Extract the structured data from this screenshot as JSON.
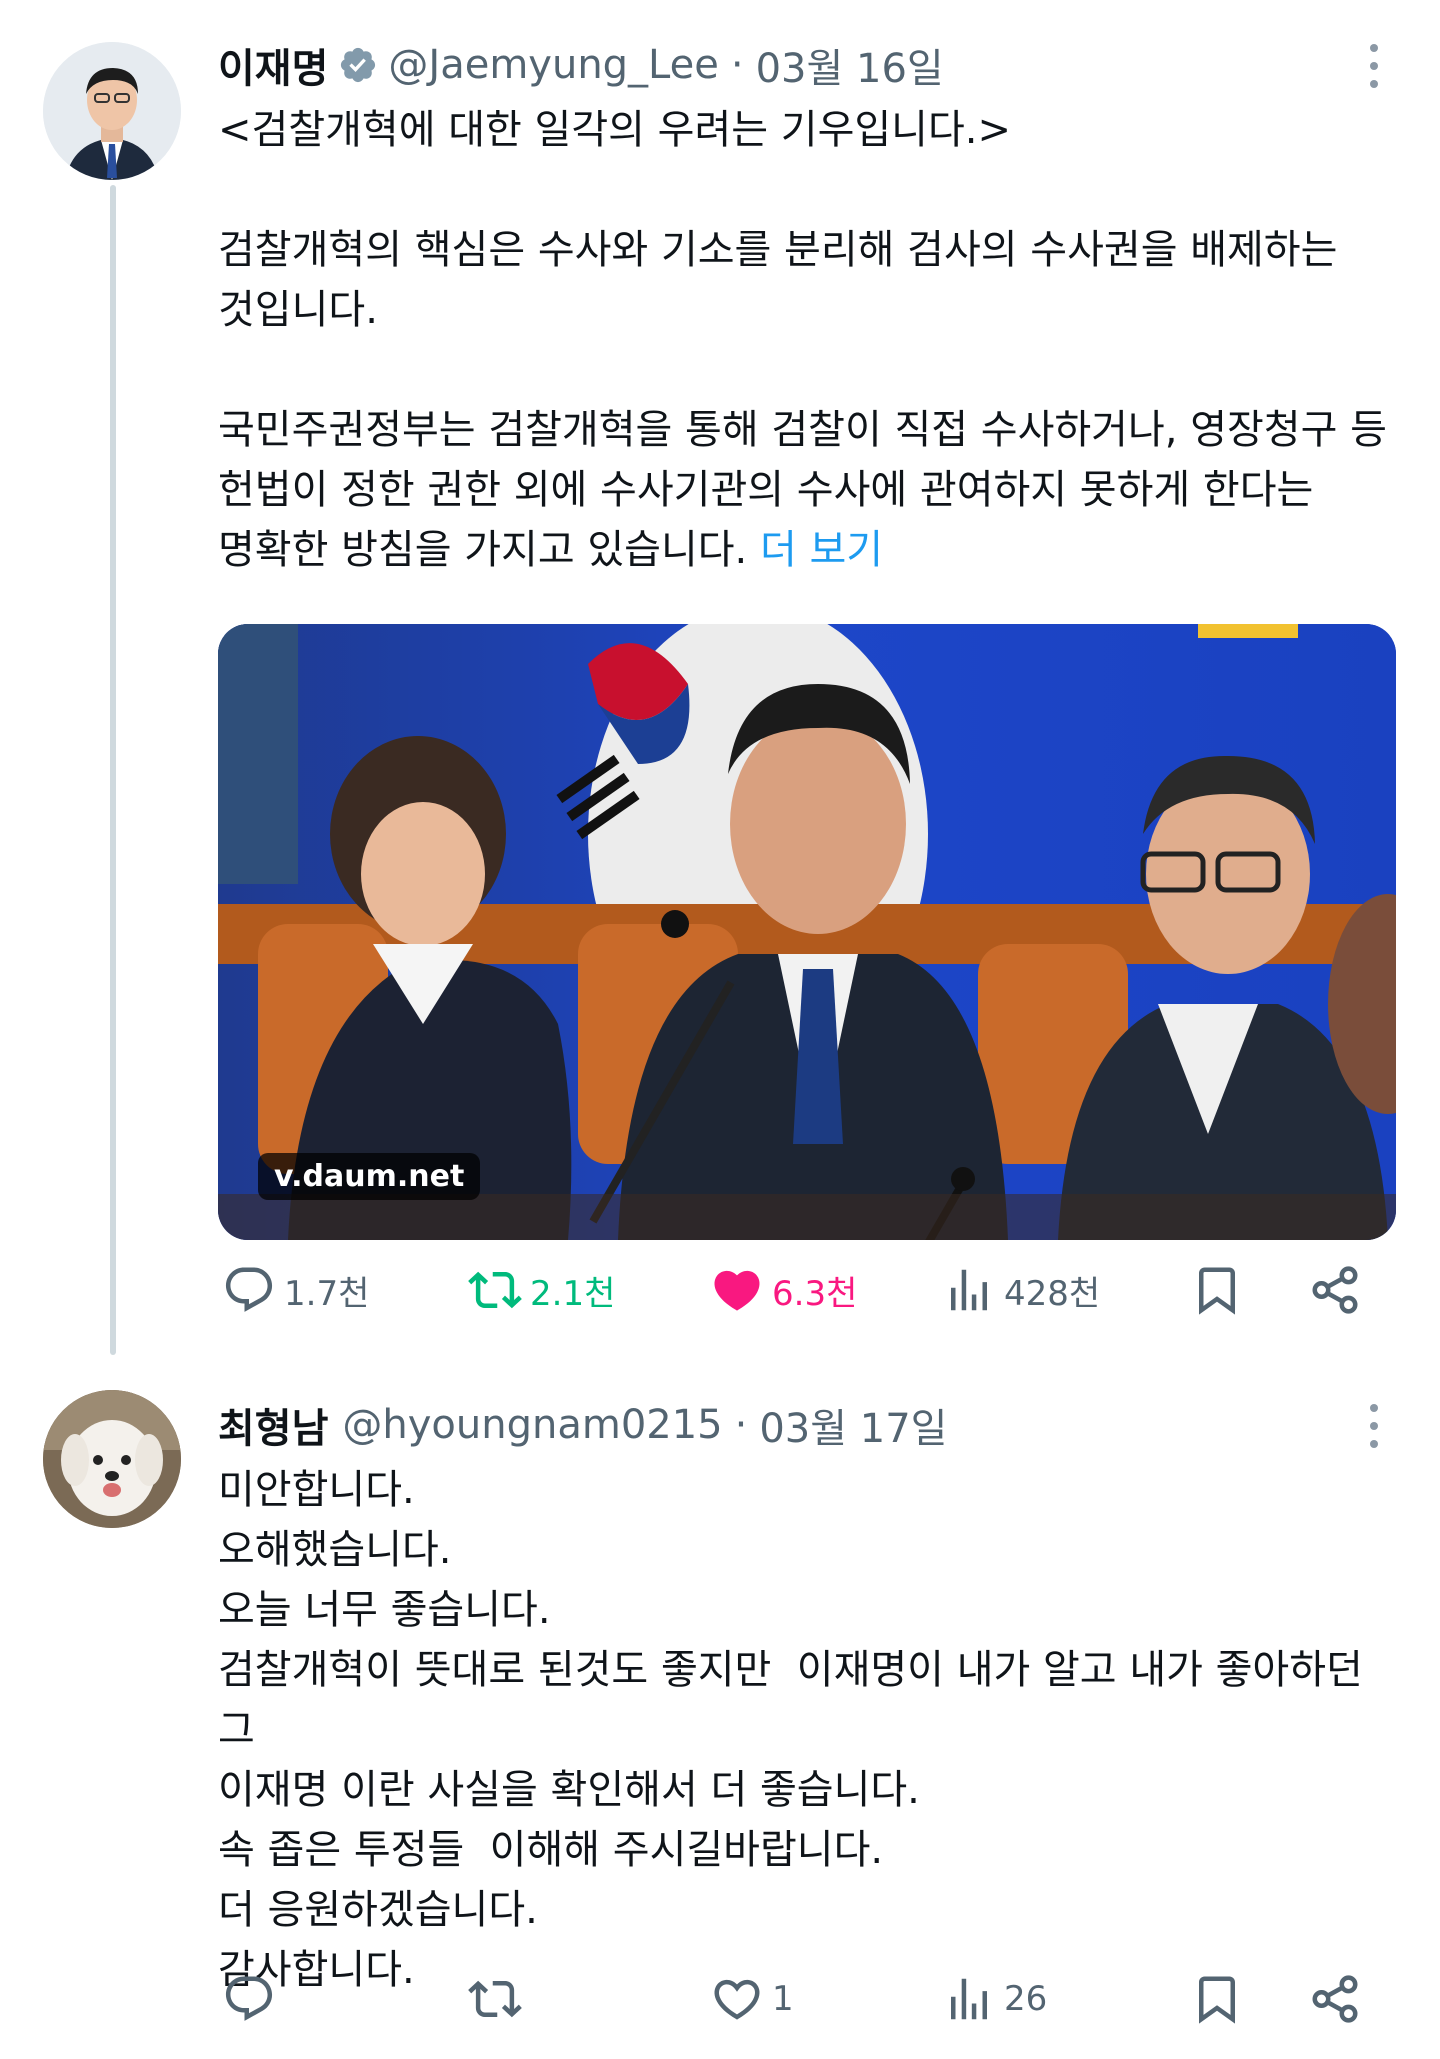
{
  "colors": {
    "accent": "#1d9bf0",
    "retweet_active": "#00ba7c",
    "like_active": "#f91880",
    "secondary_text": "#536471"
  },
  "tweets": [
    {
      "name": "이재명",
      "verified": true,
      "handle": "@Jaemyung_Lee",
      "separator": "·",
      "date": "03월 16일",
      "text_lines": [
        "<검찰개혁에 대한 일각의 우려는 기우입니다.>",
        "",
        "검찰개혁의 핵심은 수사와 기소를 분리해 검사의 수사권을 배제하는",
        "것입니다.",
        "",
        "국민주권정부는 검찰개혁을 통해 검찰이 직접 수사하거나, 영장청구 등",
        "헌법이 정한 권한 외에 수사기관의 수사에 관여하지 못하게 한다는",
        "명확한 방침을 가지고 있습니다."
      ],
      "show_more": "더 보기",
      "media_label": "v.daum.net",
      "actions": {
        "reply": "1.7천",
        "retweet": "2.1천",
        "like": "6.3천",
        "views": "428천"
      }
    },
    {
      "name": "최형남",
      "handle": "@hyoungnam0215",
      "separator": "·",
      "date": "03월 17일",
      "text_lines": [
        "미안합니다.",
        "오해했습니다.",
        "오늘 너무 좋습니다.",
        "검찰개혁이 뜻대로 된것도 좋지만  이재명이 내가 알고 내가 좋아하던 그",
        "이재명 이란 사실을 확인해서 더 좋습니다.",
        "속 좁은 투정들  이해해 주시길바랍니다.",
        "더 응원하겠습니다.",
        "감사합니다."
      ],
      "actions": {
        "reply": "",
        "retweet": "",
        "like": "1",
        "views": "26"
      }
    }
  ]
}
